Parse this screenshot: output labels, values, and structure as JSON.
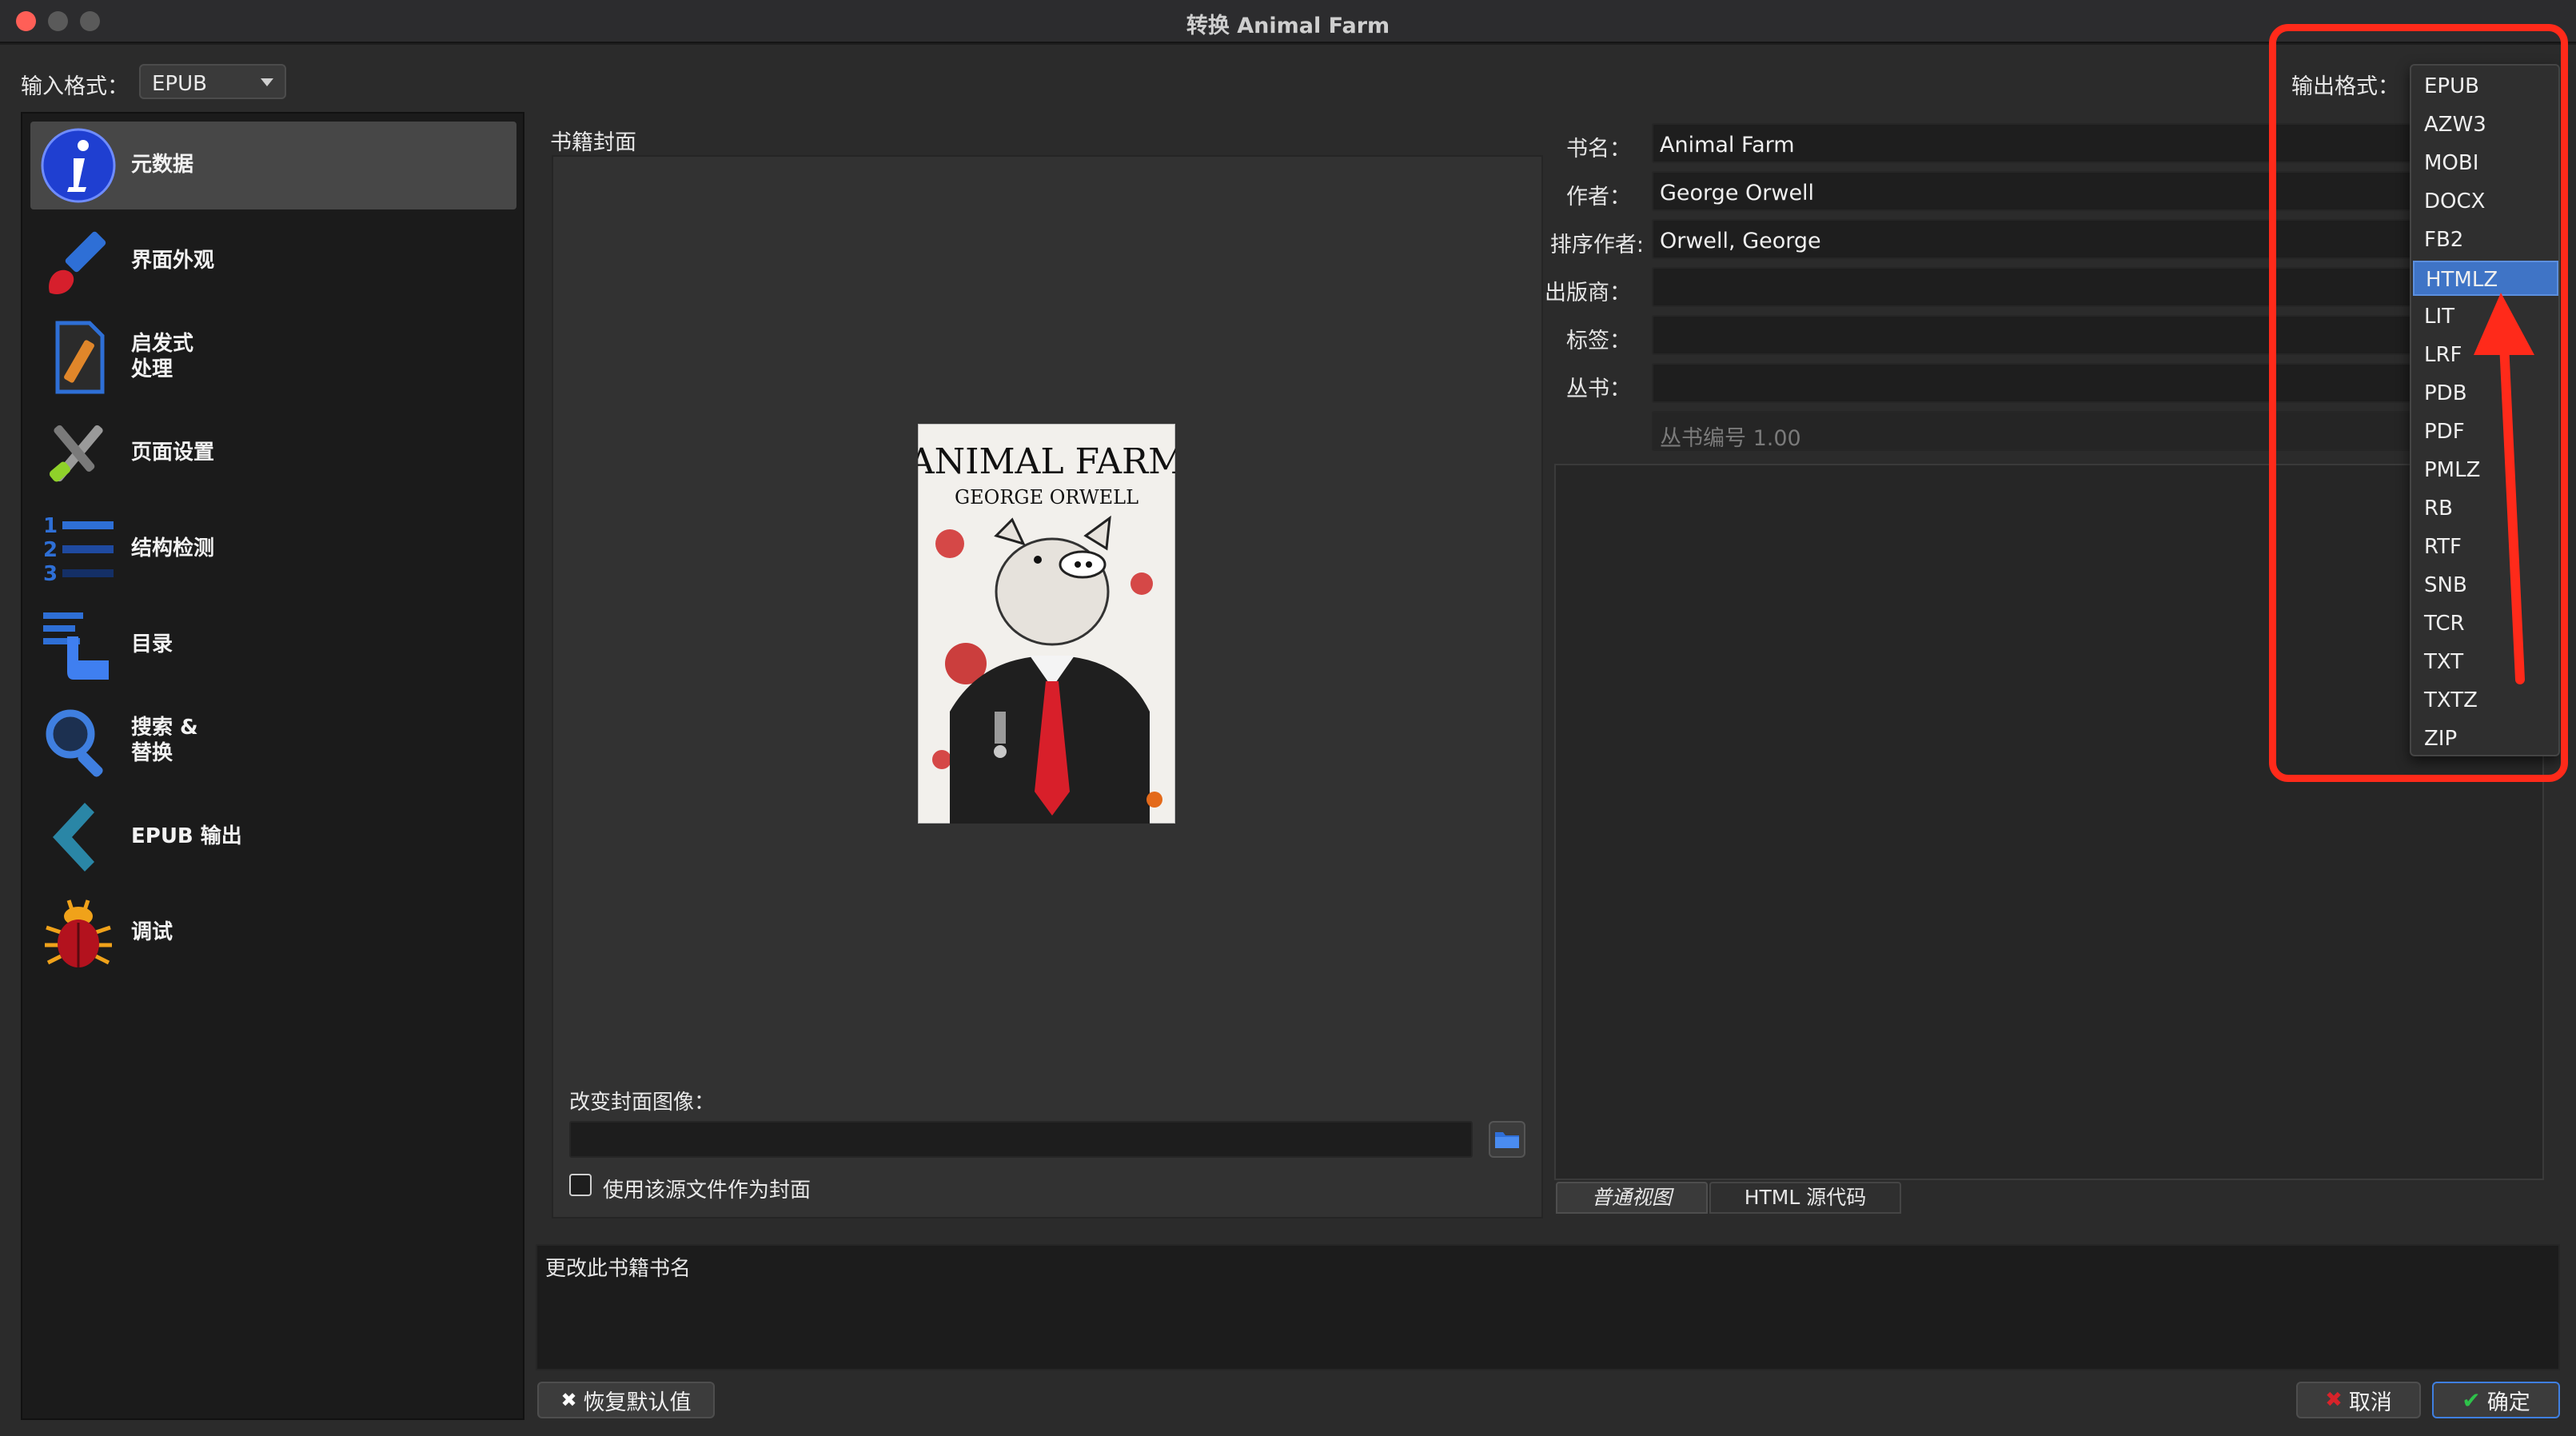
{
  "window": {
    "title": "转换 Animal Farm"
  },
  "input_format": {
    "label": "输入格式：",
    "value": "EPUB"
  },
  "output_format": {
    "label": "输出格式："
  },
  "sidebar": {
    "items": [
      {
        "label": "元数据",
        "icon": "info-icon"
      },
      {
        "label": "界面外观",
        "icon": "brush-icon"
      },
      {
        "label": "启发式\n处理",
        "icon": "document-edit-icon"
      },
      {
        "label": "页面设置",
        "icon": "tools-icon"
      },
      {
        "label": "结构检测",
        "icon": "numbered-list-icon"
      },
      {
        "label": "目录",
        "icon": "toc-icon"
      },
      {
        "label": "搜索 &\n替换",
        "icon": "search-icon"
      },
      {
        "label": "EPUB 输出",
        "icon": "epub-output-icon"
      },
      {
        "label": "调试",
        "icon": "bug-icon"
      }
    ]
  },
  "cover": {
    "section_label": "书籍封面",
    "book_title": "ANIMAL FARM",
    "book_author": "GEORGE ORWELL",
    "change_label": "改变封面图像：",
    "path_value": "",
    "checkbox_label": "使用该源文件作为封面"
  },
  "metadata": {
    "title_label": "书名：",
    "title_value": "Animal Farm",
    "author_label": "作者：",
    "author_value": "George Orwell",
    "sort_label": "排序作者:",
    "sort_value": "Orwell, George",
    "publisher_label": "出版商：",
    "publisher_value": "",
    "tags_label": "标签：",
    "tags_value": "",
    "series_label": "丛书：",
    "series_value": "",
    "series_index_placeholder": "丛书编号 1.00"
  },
  "comments": {
    "tab_normal": "普通视图",
    "tab_html": "HTML 源代码"
  },
  "help_text": "更改此书籍书名",
  "dropdown": {
    "options": [
      "EPUB",
      "AZW3",
      "MOBI",
      "DOCX",
      "FB2",
      "HTMLZ",
      "LIT",
      "LRF",
      "PDB",
      "PDF",
      "PMLZ",
      "RB",
      "RTF",
      "SNB",
      "TCR",
      "TXT",
      "TXTZ",
      "ZIP"
    ],
    "selected": "HTMLZ"
  },
  "buttons": {
    "restore": "恢复默认值",
    "cancel": "取消",
    "ok": "确定"
  },
  "colors": {
    "highlight": "#3f74c6",
    "annotation": "#ff2a1a"
  }
}
